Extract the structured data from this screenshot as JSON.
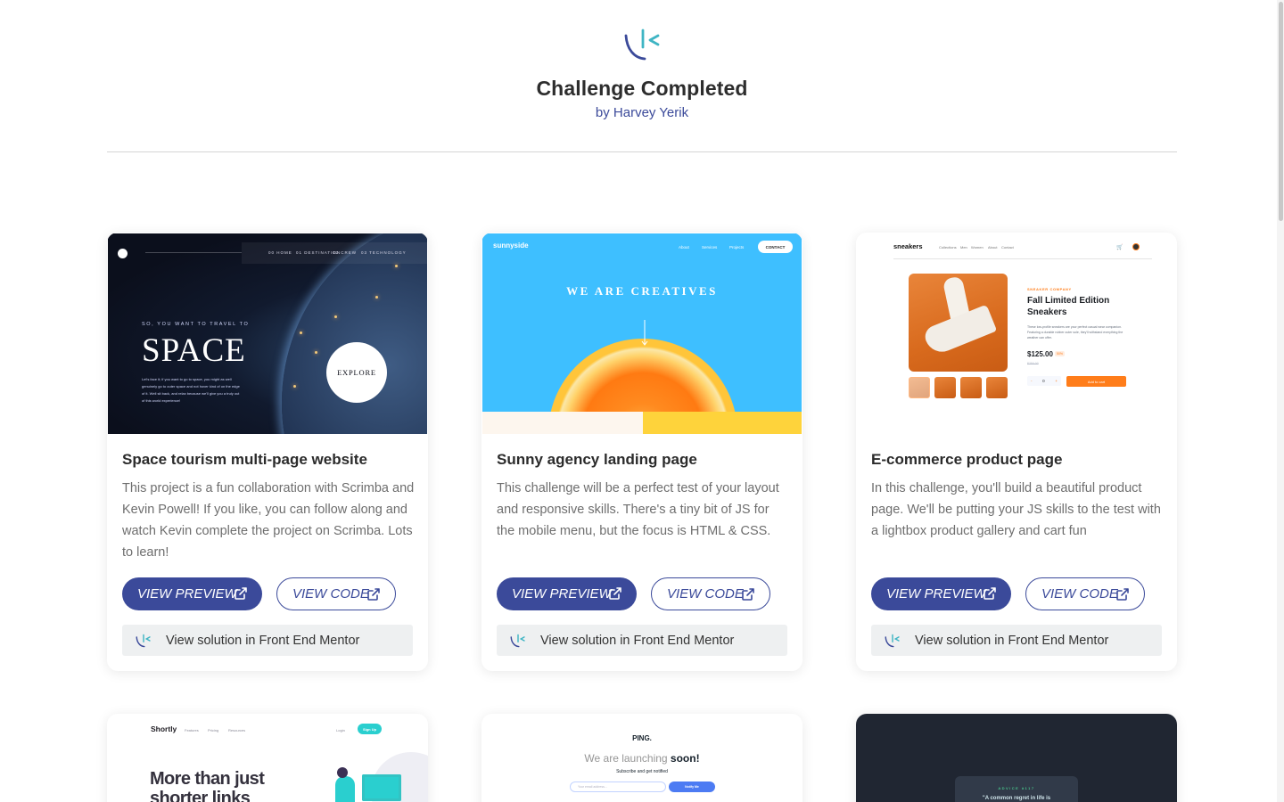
{
  "header": {
    "title": "Challenge Completed",
    "author": "by Harvey Yerik"
  },
  "colors": {
    "accent": "#3b4a9a",
    "fem_bar_bg": "#eef0f1",
    "text_muted": "#6e6e6e"
  },
  "cards": [
    {
      "title": "Space tourism multi-page website",
      "description": "This project is a fun collaboration with Scrimba and Kevin Powell! If you like, you can follow along and watch Kevin complete the project on Scrimba. Lots to learn!",
      "preview_label": "VIEW PREVIEW",
      "code_label": "VIEW CODE",
      "fem_label": "View solution in Front End Mentor",
      "thumb": {
        "nav": [
          "00 HOME",
          "01 DESTINATION",
          "02 CREW",
          "03 TECHNOLOGY"
        ],
        "kicker": "SO, YOU WANT TO TRAVEL TO",
        "hero": "SPACE",
        "lede": "Let's face it; if you want to go to space, you might as well genuinely go to outer space and not hover kind of on the edge of it. Well sit back, and relax because we'll give you a truly out of this world experience!",
        "cta": "EXPLORE"
      }
    },
    {
      "title": "Sunny agency landing page",
      "description": "This challenge will be a perfect test of your layout and responsive skills. There's a tiny bit of JS for the mobile menu, but the focus is HTML & CSS.",
      "preview_label": "VIEW PREVIEW",
      "code_label": "VIEW CODE",
      "fem_label": "View solution in Front End Mentor",
      "thumb": {
        "brand": "sunnyside",
        "nav": [
          "About",
          "Services",
          "Projects"
        ],
        "contact": "CONTACT",
        "headline": "WE ARE CREATIVES"
      }
    },
    {
      "title": "E-commerce product page",
      "description": "In this challenge, you'll build a beautiful product page. We'll be putting your JS skills to the test with a lightbox product gallery and cart fun",
      "preview_label": "VIEW PREVIEW",
      "code_label": "VIEW CODE",
      "fem_label": "View solution in Front End Mentor",
      "thumb": {
        "brand": "sneakers",
        "nav": [
          "Collections",
          "Men",
          "Women",
          "About",
          "Contact"
        ],
        "company": "SNEAKER COMPANY",
        "product": "Fall Limited Edition Sneakers",
        "desc": "These low-profile sneakers are your perfect casual wear companion. Featuring a durable rubber outer sole, they'll withstand everything the weather can offer.",
        "price": "$125.00",
        "discount": "50%",
        "old_price": "$250.00",
        "qty_minus": "-",
        "qty": "0",
        "qty_plus": "+",
        "add": "Add to cart"
      }
    }
  ],
  "row2": {
    "shortly": {
      "brand": "Shortly",
      "nav": [
        "Features",
        "Pricing",
        "Resources"
      ],
      "login": "Login",
      "signup": "Sign Up",
      "headline_1": "More than just",
      "headline_2": "shorter links"
    },
    "ping": {
      "brand": "PING.",
      "launch_prefix": "We are launching ",
      "launch_bold": "soon!",
      "sub": "Subscribe and get notified",
      "email_placeholder": "Your email address...",
      "notify": "Notify Me"
    },
    "advice": {
      "label": "ADVICE #117",
      "quote": "\"A common regret in life is"
    }
  }
}
